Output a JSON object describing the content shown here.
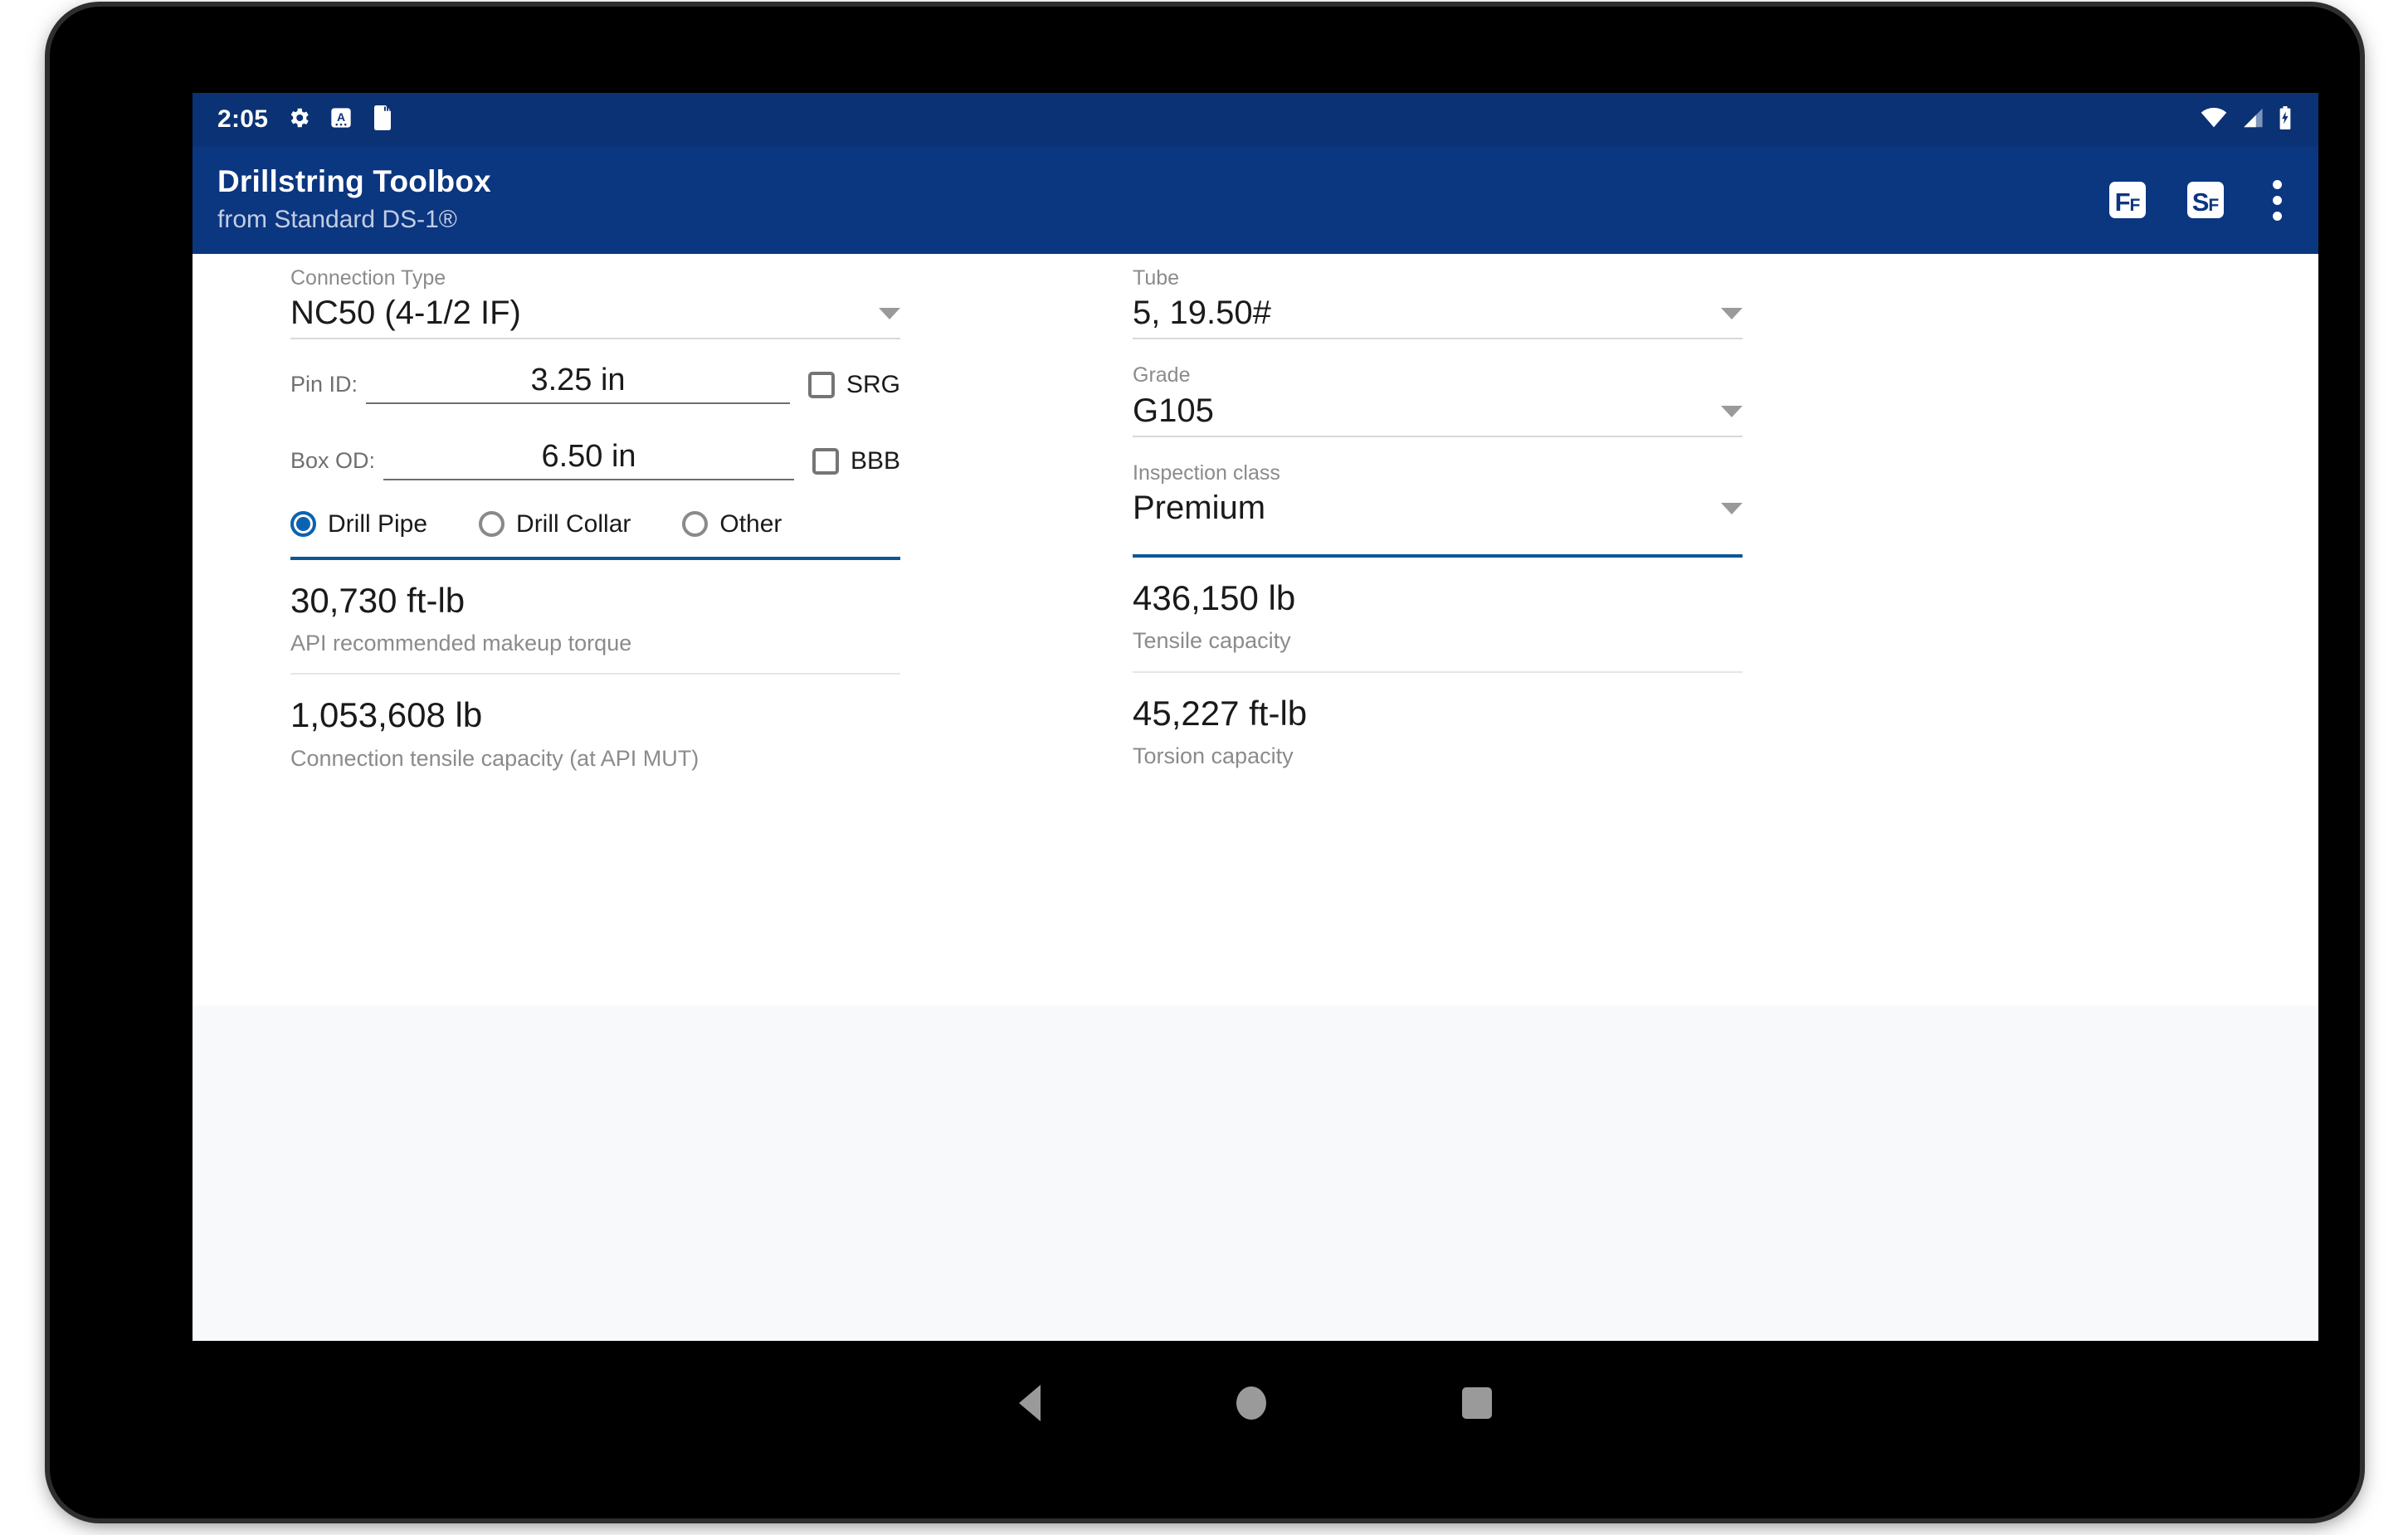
{
  "status_bar": {
    "clock": "2:05",
    "icons": [
      "gear-icon",
      "a-badge-icon",
      "sd-card-icon"
    ],
    "right_icons": [
      "wifi-icon",
      "cellular-signal-icon",
      "battery-charging-icon"
    ]
  },
  "app_bar": {
    "title": "Drillstring Toolbox",
    "subtitle": "from Standard DS-1®",
    "actions": [
      {
        "name": "ff-button",
        "big": "F",
        "small": "F"
      },
      {
        "name": "sf-button",
        "big": "S",
        "small": "F"
      }
    ],
    "overflow_label": "More options"
  },
  "colors": {
    "app_bar": "#0b3680",
    "status_bar": "#0a3275",
    "accent_blue": "#0b5896",
    "radio_blue": "#0b63b0",
    "card_bg": "#ffffff",
    "page_bg": "#f8f9fa"
  },
  "left_column": {
    "connection_type": {
      "label": "Connection Type",
      "value": "NC50 (4-1/2 IF)"
    },
    "pin_id": {
      "label": "Pin ID:",
      "value": "3.25 in",
      "checkbox_label": "SRG",
      "checked": false
    },
    "box_od": {
      "label": "Box OD:",
      "value": "6.50 in",
      "checkbox_label": "BBB",
      "checked": false
    },
    "component_type": {
      "options": [
        {
          "label": "Drill Pipe",
          "selected": true
        },
        {
          "label": "Drill Collar",
          "selected": false
        },
        {
          "label": "Other",
          "selected": false
        }
      ]
    },
    "results": [
      {
        "value": "30,730 ft-lb",
        "caption": "API recommended makeup torque"
      },
      {
        "value": "1,053,608 lb",
        "caption": "Connection tensile capacity (at API MUT)"
      }
    ]
  },
  "right_column": {
    "tube": {
      "label": "Tube",
      "value": "5, 19.50#"
    },
    "grade": {
      "label": "Grade",
      "value": "G105"
    },
    "inspection_class": {
      "label": "Inspection class",
      "value": "Premium"
    },
    "results": [
      {
        "value": "436,150 lb",
        "caption": "Tensile capacity"
      },
      {
        "value": "45,227 ft-lb",
        "caption": "Torsion capacity"
      }
    ]
  },
  "nav_bar": {
    "back": "back-button",
    "home": "home-button",
    "recents": "recents-button"
  }
}
